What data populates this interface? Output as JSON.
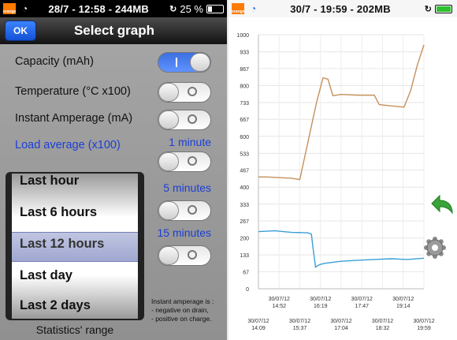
{
  "left": {
    "status": {
      "text": "28/7 - 12:58 - 244MB",
      "battery": "25 %"
    },
    "nav": {
      "ok_label": "OK",
      "title": "Select graph"
    },
    "options": {
      "capacity": "Capacity (mAh)",
      "temperature": "Temperature (°C x100)",
      "amperage": "Instant Amperage (mA)",
      "load_average": "Load average (x100)"
    },
    "toggles": {
      "capacity": true,
      "temperature": false,
      "amperage": false,
      "load_1": false,
      "load_5": false,
      "load_15": false
    },
    "intervals": [
      "1 minute",
      "5 minutes",
      "15 minutes"
    ],
    "picker": {
      "items": [
        "Last hour",
        "Last 6 hours",
        "Last 12 hours",
        "Last day",
        "Last 2 days"
      ],
      "selected": "Last 12 hours",
      "label": "Statistics' range"
    },
    "note_lines": [
      "Instant amperage is :",
      "- negative on drain,",
      "- positive on charge."
    ]
  },
  "right": {
    "status": {
      "text": "30/7 - 19:59 - 202MB"
    },
    "chart_data": {
      "type": "line",
      "y_ticks": [
        "1000",
        "933",
        "867",
        "800",
        "733",
        "667",
        "600",
        "533",
        "467",
        "400",
        "333",
        "267",
        "200",
        "133",
        "67",
        "0"
      ],
      "ylim": [
        0,
        1000
      ],
      "x_ticks_upper": [
        [
          "30/07/12",
          "14:52"
        ],
        [
          "30/07/12",
          "16:19"
        ],
        [
          "30/07/12",
          "17:47"
        ],
        [
          "30/07/12",
          "19:14"
        ]
      ],
      "x_ticks_lower": [
        [
          "30/07/12",
          "14:09"
        ],
        [
          "30/07/12",
          "15:37"
        ],
        [
          "30/07/12",
          "17:04"
        ],
        [
          "30/07/12",
          "18:32"
        ],
        [
          "30/07/12",
          "19:59"
        ]
      ],
      "series": [
        {
          "color": "#c4905c",
          "points": [
            [
              0,
              440
            ],
            [
              0.05,
              440
            ],
            [
              0.2,
              435
            ],
            [
              0.25,
              430
            ],
            [
              0.3,
              580
            ],
            [
              0.35,
              730
            ],
            [
              0.39,
              830
            ],
            [
              0.42,
              825
            ],
            [
              0.45,
              760
            ],
            [
              0.5,
              765
            ],
            [
              0.6,
              762
            ],
            [
              0.7,
              762
            ],
            [
              0.73,
              725
            ],
            [
              0.8,
              720
            ],
            [
              0.88,
              715
            ],
            [
              0.92,
              780
            ],
            [
              0.96,
              880
            ],
            [
              1.0,
              960
            ]
          ]
        },
        {
          "color": "#3a9fd6",
          "points": [
            [
              0,
              225
            ],
            [
              0.1,
              228
            ],
            [
              0.2,
              222
            ],
            [
              0.3,
              220
            ],
            [
              0.32,
              215
            ],
            [
              0.33,
              160
            ],
            [
              0.345,
              85
            ],
            [
              0.37,
              95
            ],
            [
              0.4,
              100
            ],
            [
              0.5,
              108
            ],
            [
              0.6,
              112
            ],
            [
              0.7,
              115
            ],
            [
              0.8,
              118
            ],
            [
              0.9,
              115
            ],
            [
              1.0,
              120
            ]
          ]
        }
      ]
    },
    "icons": {
      "back": "undo-arrow-icon",
      "settings": "gear-icon"
    }
  }
}
